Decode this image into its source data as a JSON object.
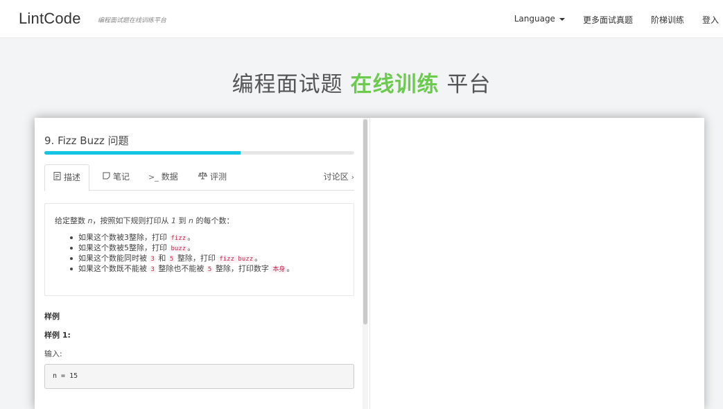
{
  "navbar": {
    "brand": "LintCode",
    "tagline": "编程面试题在线训练平台",
    "language_label": "Language",
    "links": [
      "更多面试真题",
      "阶梯训练",
      "登入"
    ]
  },
  "hero": {
    "part1": "编程面试题 ",
    "accent": "在线训练",
    "part2": " 平台",
    "accent_color": "#6ccb4e"
  },
  "problem": {
    "title": "9. Fizz Buzz 问题",
    "progress_fraction": 0.634,
    "progress_color": "#14c4e4",
    "tabs": [
      {
        "label": "描述",
        "icon": "document-icon"
      },
      {
        "label": "笔记",
        "icon": "note-icon"
      },
      {
        "label": "数据",
        "icon": "terminal-icon"
      },
      {
        "label": "评测",
        "icon": "scale-icon"
      }
    ],
    "discuss_label": "讨论区",
    "description": {
      "intro_prefix": "给定整数 ",
      "intro_n": "n",
      "intro_mid": "，按照如下规则打印从 ",
      "intro_one": "1",
      "intro_mid2": " 到 ",
      "intro_n2": "n",
      "intro_suffix": " 的每个数：",
      "rule1_text": "如果这个数被3整除，打印 ",
      "rule1_code": "fizz",
      "rule1_end": "。",
      "rule2_text": "如果这个数被5整除，打印 ",
      "rule2_code": "buzz",
      "rule2_end": "。",
      "rule3_text": "如果这个数能同时被 ",
      "rule3_code1": "3",
      "rule3_and": " 和 ",
      "rule3_code2": "5",
      "rule3_mid": " 整除，打印 ",
      "rule3_code3": "fizz buzz",
      "rule3_end": "。",
      "rule4_text": "如果这个数既不能被 ",
      "rule4_code1": "3",
      "rule4_mid": " 整除也不能被 ",
      "rule4_code2": "5",
      "rule4_mid2": " 整除，打印数字 ",
      "rule4_code3": "本身",
      "rule4_end": "。"
    },
    "example_heading": "样例",
    "example1_heading": "样例 1:",
    "input_label": "输入:",
    "input_value": "n = 15"
  }
}
